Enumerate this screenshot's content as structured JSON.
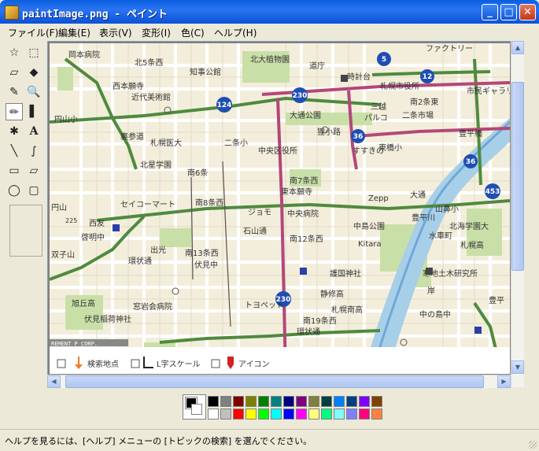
{
  "window": {
    "title": "paintImage.png - ペイント",
    "min_glyph": "_",
    "max_glyph": "□",
    "close_glyph": "✕"
  },
  "menu": [
    "ファイル(F)",
    "編集(E)",
    "表示(V)",
    "変形(I)",
    "色(C)",
    "ヘルプ(H)"
  ],
  "tools": [
    {
      "name": "free-select",
      "glyph": "☆"
    },
    {
      "name": "rect-select",
      "glyph": "⬚"
    },
    {
      "name": "eraser",
      "glyph": "▱"
    },
    {
      "name": "fill",
      "glyph": "◆"
    },
    {
      "name": "picker",
      "glyph": "✎"
    },
    {
      "name": "magnifier",
      "glyph": "🔍"
    },
    {
      "name": "pencil",
      "glyph": "✏"
    },
    {
      "name": "brush",
      "glyph": "▌"
    },
    {
      "name": "airbrush",
      "glyph": "✱"
    },
    {
      "name": "text",
      "glyph": "A"
    },
    {
      "name": "line",
      "glyph": "╲"
    },
    {
      "name": "curve",
      "glyph": "∫"
    },
    {
      "name": "rectangle",
      "glyph": "▭"
    },
    {
      "name": "polygon",
      "glyph": "▱"
    },
    {
      "name": "ellipse",
      "glyph": "◯"
    },
    {
      "name": "rounded-rect",
      "glyph": "▢"
    }
  ],
  "map": {
    "labels": [
      "岡本病院",
      "北5条西",
      "北大植物園",
      "道庁",
      "時計台",
      "札幌市役所",
      "ファクトリー",
      "西本願寺",
      "近代美術館",
      "知事公館",
      "三越",
      "パルコ",
      "南2条東",
      "二条市場",
      "市民ギャラリー",
      "大通公園",
      "豊平橋",
      "円山小",
      "裏参道",
      "札幌医大",
      "二条小",
      "すすきの",
      "東橋小",
      "狸小路",
      "北星学園",
      "南6条",
      "南7条西",
      "東本願寺",
      "中央区役所",
      "Zepp",
      "大通",
      "セイコーマート",
      "南8条西",
      "ジョモ",
      "中央病院",
      "豊平川",
      "山鼻小",
      "北海学園大",
      "水車町",
      "円山",
      "西友",
      "啓明中",
      "出光",
      "中島公園",
      "Kitara",
      "札幌高",
      "南12条西",
      "南13条西",
      "環状通",
      "石山通",
      "伏見中",
      "護国神社",
      "寒地土木研究所",
      "静修高",
      "双子山",
      "旭丘高",
      "窓岩会病院",
      "伏見稲荷神社",
      "トヨペット",
      "札幌南高",
      "南19条西",
      "環状通",
      "中の島中",
      "岸",
      "豊平",
      "225"
    ],
    "route_numbers": [
      "5",
      "12",
      "124",
      "230",
      "36",
      "36",
      "453",
      "230"
    ],
    "credit": "REMENT P CORP."
  },
  "legend": {
    "items": [
      "検索地点",
      "L字スケール",
      "アイコン"
    ]
  },
  "palette": {
    "top": [
      "#000000",
      "#808080",
      "#800000",
      "#808000",
      "#008000",
      "#008080",
      "#000080",
      "#800080",
      "#808040",
      "#004040",
      "#0080ff",
      "#004080",
      "#8000ff",
      "#804000"
    ],
    "bottom": [
      "#ffffff",
      "#c0c0c0",
      "#ff0000",
      "#ffff00",
      "#00ff00",
      "#00ffff",
      "#0000ff",
      "#ff00ff",
      "#ffff80",
      "#00ff80",
      "#80ffff",
      "#8080ff",
      "#ff0080",
      "#ff8040"
    ]
  },
  "status": {
    "text": "ヘルプを見るには、[ヘルプ] メニューの [トピックの検索] を選んでください。"
  }
}
